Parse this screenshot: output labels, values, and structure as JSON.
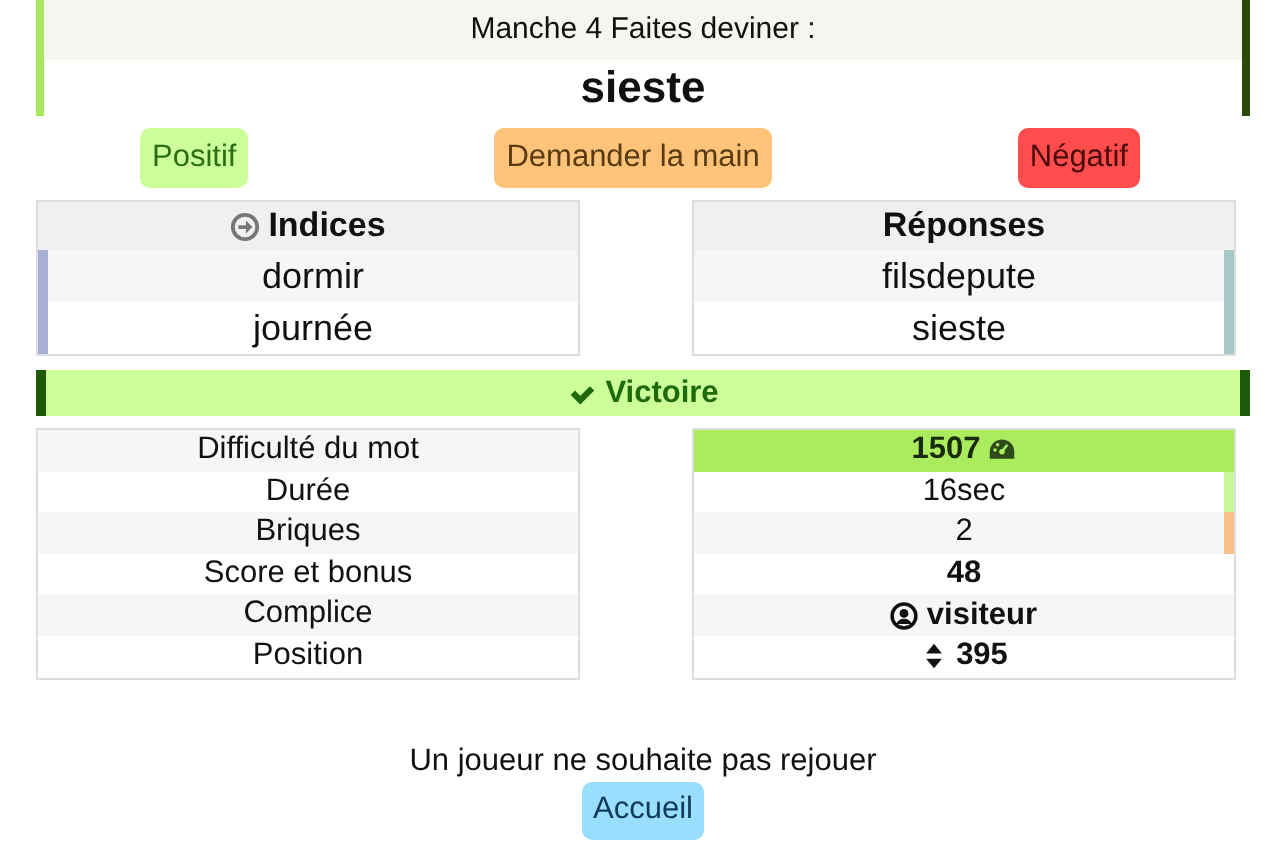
{
  "round": {
    "title": "Manche 4 Faites deviner :",
    "word": "sieste"
  },
  "actions": [
    {
      "label": "Positif",
      "kind": "positive"
    },
    {
      "label": "Demander la main",
      "kind": "ask"
    },
    {
      "label": "Négatif",
      "kind": "negative"
    }
  ],
  "clues": {
    "heading": "Indices",
    "color": "#a9aed6",
    "items": [
      "dormir",
      "journée"
    ]
  },
  "answers": {
    "heading": "Réponses",
    "color": "#a8c8c8",
    "items": [
      "filsdepute",
      "sieste"
    ]
  },
  "result": {
    "label": "Victoire",
    "kind": "win"
  },
  "stats": [
    {
      "label": "Difficulté du mot",
      "value": "1507",
      "kind": "difficulty"
    },
    {
      "label": "Durée",
      "value": "16sec",
      "kind": "plain",
      "color": "#c9f99a"
    },
    {
      "label": "Briques",
      "value": "2",
      "kind": "plain",
      "color": "#f8c08a"
    },
    {
      "label": "Score et bonus",
      "value": "48",
      "kind": "bold"
    },
    {
      "label": "Complice",
      "value": "visiteur",
      "kind": "player"
    },
    {
      "label": "Position",
      "value": "395",
      "kind": "position"
    }
  ],
  "footer": {
    "message": "Un joueur ne souhaite pas rejouer",
    "button": "Accueil"
  }
}
